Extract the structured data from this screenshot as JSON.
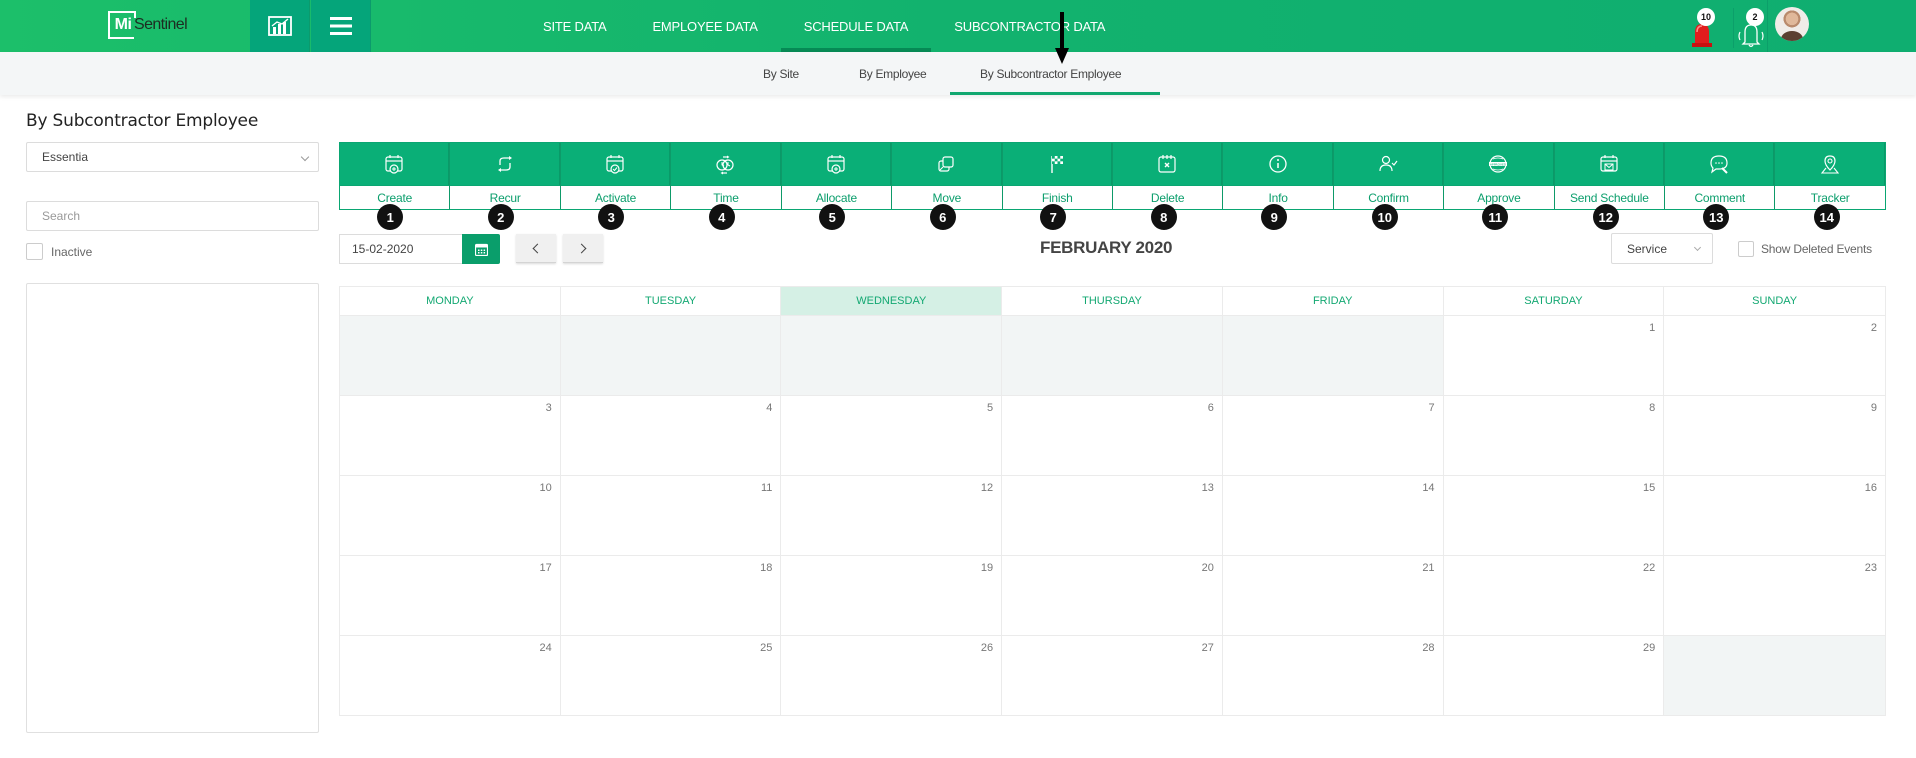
{
  "app": {
    "logo_mi": "Mi",
    "logo_rest": "Sentinel"
  },
  "topnav": {
    "items": [
      {
        "label": "SITE DATA",
        "active": false
      },
      {
        "label": "EMPLOYEE DATA",
        "active": false
      },
      {
        "label": "SCHEDULE DATA",
        "active": true
      },
      {
        "label": "SUBCONTRACTOR DATA",
        "active": false
      }
    ],
    "chart_icon": "analytics-chart-icon",
    "menu_icon": "hamburger-menu-icon",
    "alarm_count": "10",
    "notification_count": "2"
  },
  "subnav": {
    "items": [
      {
        "label": "By Site",
        "active": false
      },
      {
        "label": "By Employee",
        "active": false
      },
      {
        "label": "By Subcontractor Employee",
        "active": true
      }
    ]
  },
  "left_panel": {
    "title": "By Subcontractor Employee",
    "site_select_value": "Essentia",
    "search_placeholder": "Search",
    "search_value": "",
    "inactive_label": "Inactive",
    "inactive_checked": false
  },
  "toolbar": {
    "actions": [
      {
        "label": "Create",
        "icon": "calendar-plus-icon",
        "step": "1"
      },
      {
        "label": "Recur",
        "icon": "recur-arrows-icon",
        "step": "2"
      },
      {
        "label": "Activate",
        "icon": "calendar-check-icon",
        "step": "3"
      },
      {
        "label": "Time",
        "icon": "clock-swap-icon",
        "step": "4"
      },
      {
        "label": "Allocate",
        "icon": "calendar-plus-icon",
        "step": "5"
      },
      {
        "label": "Move",
        "icon": "move-copy-icon",
        "step": "6"
      },
      {
        "label": "Finish",
        "icon": "checkered-flag-icon",
        "step": "7"
      },
      {
        "label": "Delete",
        "icon": "calendar-x-icon",
        "step": "8"
      },
      {
        "label": "Info",
        "icon": "info-circle-icon",
        "step": "9"
      },
      {
        "label": "Confirm",
        "icon": "user-check-icon",
        "step": "10"
      },
      {
        "label": "Approve",
        "icon": "approved-stamp-icon",
        "step": "11"
      },
      {
        "label": "Send Schedule",
        "icon": "calendar-mail-icon",
        "step": "12"
      },
      {
        "label": "Comment",
        "icon": "comment-edit-icon",
        "step": "13"
      },
      {
        "label": "Tracker",
        "icon": "map-pin-icon",
        "step": "14"
      }
    ]
  },
  "controls": {
    "date_value": "15-02-2020",
    "month_title": "FEBRUARY 2020",
    "service_select_value": "Service",
    "show_deleted_label": "Show Deleted Events",
    "show_deleted_checked": false
  },
  "calendar": {
    "weekdays": [
      "MONDAY",
      "TUESDAY",
      "WEDNESDAY",
      "THURSDAY",
      "FRIDAY",
      "SATURDAY",
      "SUNDAY"
    ],
    "today_weekday_index": 2,
    "cells": [
      {
        "day": "",
        "out": true
      },
      {
        "day": "",
        "out": true
      },
      {
        "day": "",
        "out": true
      },
      {
        "day": "",
        "out": true
      },
      {
        "day": "",
        "out": true
      },
      {
        "day": "1",
        "out": false
      },
      {
        "day": "2",
        "out": false
      },
      {
        "day": "3",
        "out": false
      },
      {
        "day": "4",
        "out": false
      },
      {
        "day": "5",
        "out": false
      },
      {
        "day": "6",
        "out": false
      },
      {
        "day": "7",
        "out": false
      },
      {
        "day": "8",
        "out": false
      },
      {
        "day": "9",
        "out": false
      },
      {
        "day": "10",
        "out": false
      },
      {
        "day": "11",
        "out": false
      },
      {
        "day": "12",
        "out": false
      },
      {
        "day": "13",
        "out": false
      },
      {
        "day": "14",
        "out": false
      },
      {
        "day": "15",
        "out": false
      },
      {
        "day": "16",
        "out": false
      },
      {
        "day": "17",
        "out": false
      },
      {
        "day": "18",
        "out": false
      },
      {
        "day": "19",
        "out": false
      },
      {
        "day": "20",
        "out": false
      },
      {
        "day": "21",
        "out": false
      },
      {
        "day": "22",
        "out": false
      },
      {
        "day": "23",
        "out": false
      },
      {
        "day": "24",
        "out": false
      },
      {
        "day": "25",
        "out": false
      },
      {
        "day": "26",
        "out": false
      },
      {
        "day": "27",
        "out": false
      },
      {
        "day": "28",
        "out": false
      },
      {
        "day": "29",
        "out": false
      },
      {
        "day": "",
        "out": true
      }
    ]
  }
}
